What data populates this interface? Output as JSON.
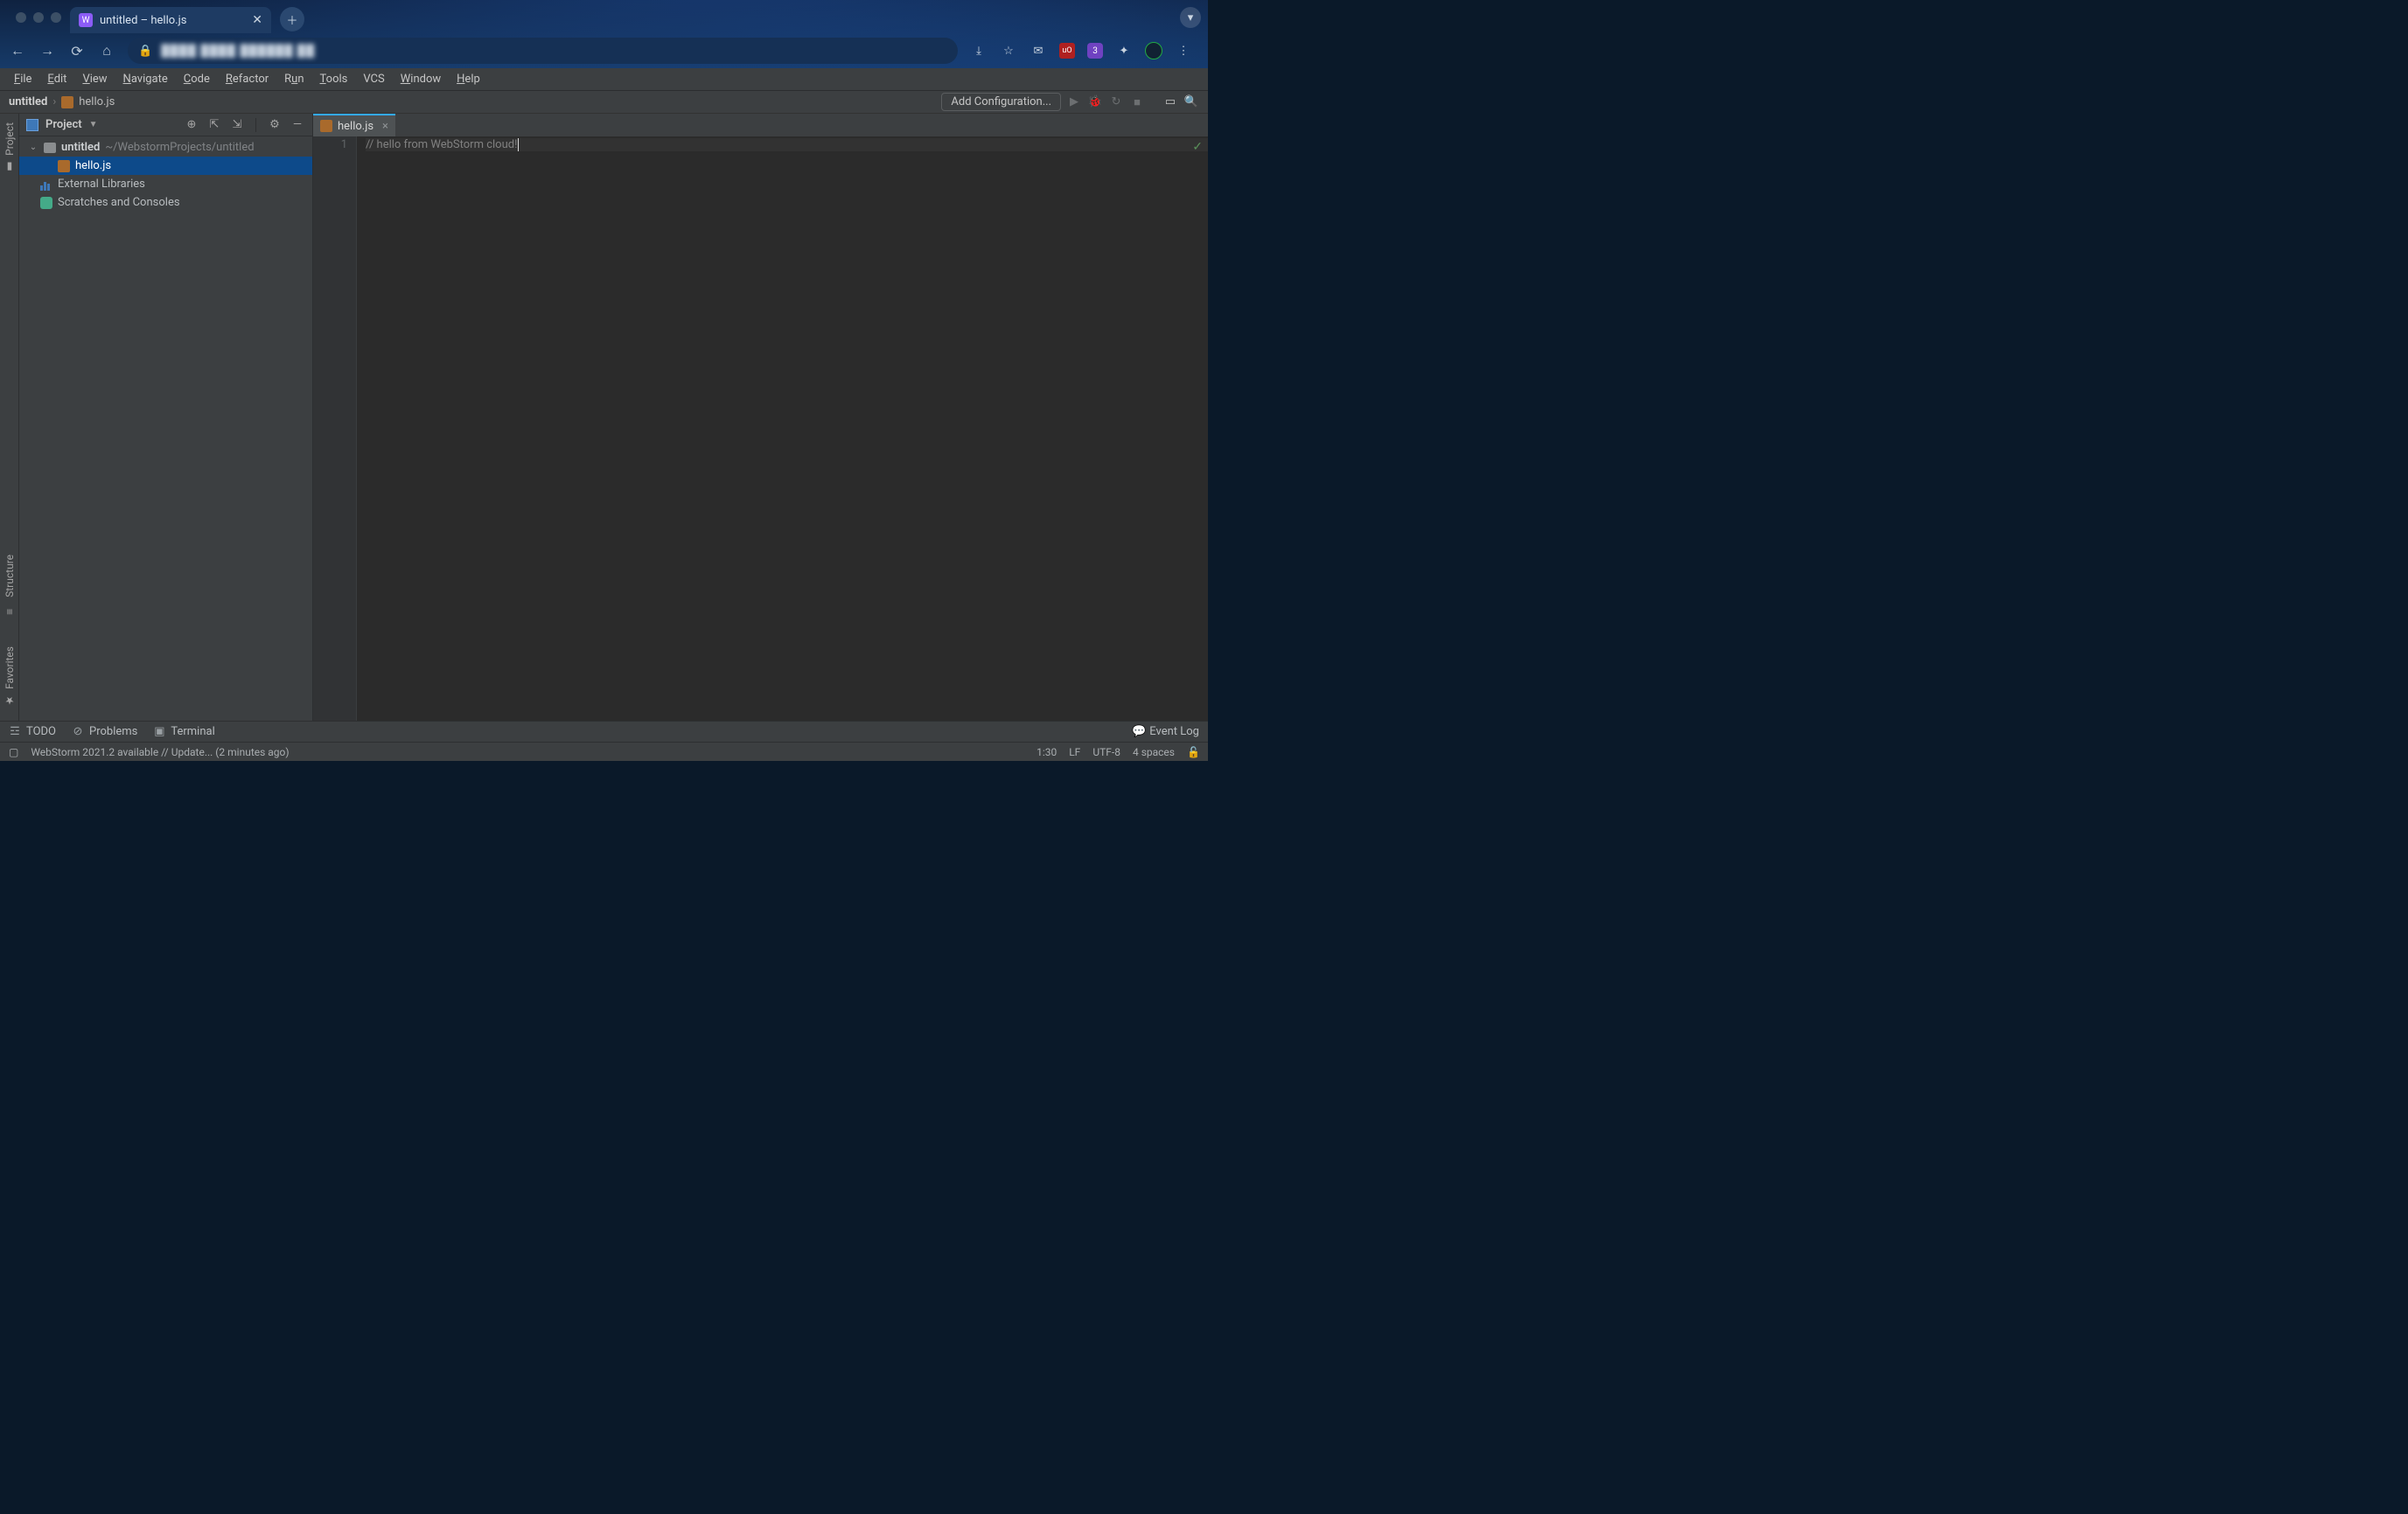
{
  "browser": {
    "tab_title": "untitled – hello.js",
    "ext_badge": "3",
    "ublock": "uO"
  },
  "menubar": {
    "items": [
      "File",
      "Edit",
      "View",
      "Navigate",
      "Code",
      "Refactor",
      "Run",
      "Tools",
      "VCS",
      "Window",
      "Help"
    ]
  },
  "breadcrumb": {
    "project": "untitled",
    "file": "hello.js",
    "add_configuration": "Add Configuration..."
  },
  "project_pane": {
    "header_label": "Project",
    "root_name": "untitled",
    "root_path": "~/WebstormProjects/untitled",
    "file_name": "hello.js",
    "external_libs": "External Libraries",
    "scratches": "Scratches and Consoles"
  },
  "left_tool_windows": {
    "project": "Project",
    "structure": "Structure",
    "favorites": "Favorites"
  },
  "editor": {
    "tab_label": "hello.js",
    "line_number": "1",
    "line1": "// hello from WebStorm cloud!"
  },
  "bottom_tool_windows": {
    "todo": "TODO",
    "problems": "Problems",
    "terminal": "Terminal",
    "event_log": "Event Log"
  },
  "status": {
    "notification": "WebStorm 2021.2 available // Update... (2 minutes ago)",
    "caret": "1:30",
    "line_sep": "LF",
    "encoding": "UTF-8",
    "indent": "4 spaces"
  }
}
